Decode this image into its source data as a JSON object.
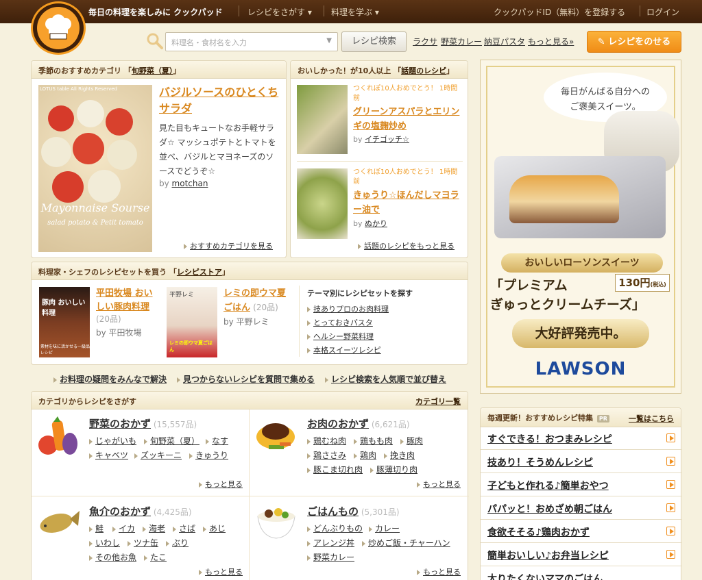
{
  "header": {
    "tagline": "毎日の料理を楽しみに クックパッド",
    "nav": [
      "レシピをさがす ▾",
      "料理を学ぶ ▾"
    ],
    "register": "クックパッドID（無料）を登録する",
    "login": "ログイン"
  },
  "search": {
    "placeholder": "料理名・食材名を入力",
    "button": "レシピ検索",
    "quick": [
      "ラクサ",
      "野菜カレー",
      "納豆パスタ",
      "もっと見る»"
    ],
    "post_button": "レシピをのせる"
  },
  "seasonal": {
    "header_prefix": "季節のおすすめカテゴリ 「",
    "header_link": "旬野菜（夏）",
    "header_suffix": "」",
    "image_caption_top": "LOTUS table All Rights Reserved",
    "image_caption_main": "Mayonnaise Sourse",
    "image_caption_sub": "salad potato & Petit tomato",
    "title": "バジルソースのひとくちサラダ",
    "desc": "見た目もキュートなお手軽サラダ☆ マッシュポテトとトマトを並べ、バジルとマヨネーズのソースでどうぞ☆",
    "by": "by",
    "author": "motchan",
    "more": "おすすめカテゴリを見る"
  },
  "popular": {
    "header_prefix": "おいしかった！が10人以上 「",
    "header_link": "話題のレシピ",
    "header_suffix": "」",
    "items": [
      {
        "meta": "つくれぽ10人おめでとう！ 1時間前",
        "title": "グリーンアスパラとエリンギの塩麹炒め",
        "by": "by",
        "author": "イチゴッチ☆"
      },
      {
        "meta": "つくれぽ10人おめでとう！ 1時間前",
        "title": "きゅうり☆ほんだしマヨラー油で",
        "by": "by",
        "author": "ぬかり"
      }
    ],
    "more": "話題のレシピをもっと見る"
  },
  "store": {
    "header_prefix": "料理家・シェフのレシピセットを買う 「",
    "header_link": "レシピストア",
    "header_suffix": "」",
    "items": [
      {
        "title": "平田牧場 おいしい豚肉料理",
        "count": "(20品)",
        "by": "by 平田牧場",
        "thumb_text": "豚肉 おいしい 料理",
        "thumb_caption": "素材を味に活かせる一級品レシピ"
      },
      {
        "title": "レミの即ウマ夏ごはん",
        "count": "(20品)",
        "by": "by 平野レミ",
        "thumb_text": "平野レミ",
        "thumb_caption": "レミの即ウマ夏ごはん"
      }
    ],
    "theme_title": "テーマ別にレシピセットを探す",
    "themes": [
      "技ありプロのお肉料理",
      "とっておきパスタ",
      "ヘルシー野菜料理",
      "本格スイーツレシピ"
    ]
  },
  "promo_links": [
    "お料理の疑問をみんなで解決",
    "見つからないレシピを質問で集める",
    "レシピ検索を人気順で並び替え"
  ],
  "categories": {
    "header": "カテゴリからレシピをさがす",
    "all_link": "カテゴリ一覧",
    "more": "もっと見る",
    "groups": [
      {
        "name": "野菜のおかず",
        "count": "(15,557品)",
        "tags": [
          [
            "じゃがいも",
            "旬野菜（夏）",
            "なす"
          ],
          [
            "キャベツ",
            "ズッキーニ",
            "きゅうり"
          ]
        ]
      },
      {
        "name": "お肉のおかず",
        "count": "(6,621品)",
        "tags": [
          [
            "鶏むね肉",
            "鶏もも肉",
            "豚肉"
          ],
          [
            "鶏ささみ",
            "鶏肉",
            "挽き肉"
          ],
          [
            "豚こま切れ肉",
            "豚薄切り肉"
          ]
        ]
      },
      {
        "name": "魚介のおかず",
        "count": "(4,425品)",
        "tags": [
          [
            "鮭",
            "イカ",
            "海老",
            "さば",
            "あじ"
          ],
          [
            "いわし",
            "ツナ缶",
            "ぶり"
          ],
          [
            "その他お魚",
            "たこ"
          ]
        ]
      },
      {
        "name": "ごはんもの",
        "count": "(5,301品)",
        "tags": [
          [
            "どんぶりもの",
            "カレー"
          ],
          [
            "アレンジ丼",
            "炒めご飯・チャーハン"
          ],
          [
            "野菜カレー"
          ]
        ]
      }
    ]
  },
  "ad": {
    "bubble_line1": "毎日がんばる自分への",
    "bubble_line2": "ご褒美スイーツ。",
    "ribbon": "おいしいローソンスイーツ",
    "product_line1": "「プレミアム",
    "product_line2": "ぎゅっとクリームチーズ」",
    "price": "130円",
    "price_note": "(税込)",
    "badge": "大好評発売中。",
    "brand": "LAWSON"
  },
  "featured": {
    "header": "毎週更新！おすすめレシピ特集",
    "pr": "PR",
    "link": "一覧はこちら",
    "items": [
      "すぐできる！おつまみレシピ",
      "技あり！そうめんレシピ",
      "子どもと作れる♪簡単おやつ",
      "パパッと！おめざめ朝ごはん",
      "食欲そそる♪鶏肉おかず",
      "簡単おいしい♪お弁当レシピ",
      "太りたくないママのごはん"
    ]
  },
  "colors": {
    "topbar": "#4a280e",
    "accent": "#f39a1e",
    "link_orange": "#d9881f",
    "bg": "#f6f1de"
  }
}
